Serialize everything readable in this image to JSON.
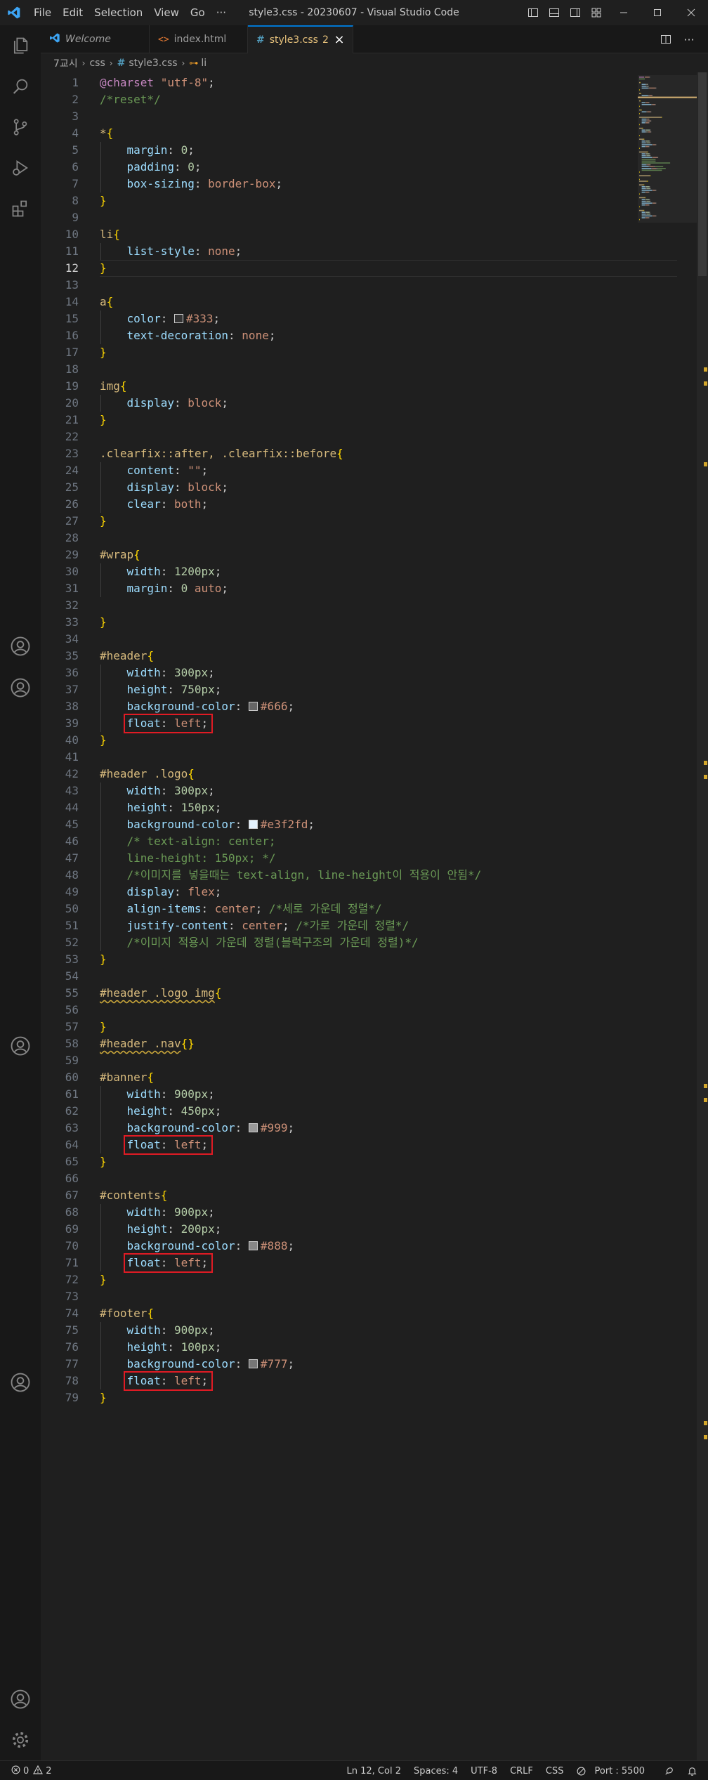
{
  "app": {
    "window_title": "style3.css - 20230607 - Visual Studio Code",
    "menu": [
      "File",
      "Edit",
      "Selection",
      "View",
      "Go",
      "···"
    ]
  },
  "tabs": [
    {
      "label": "Welcome",
      "icon": "vscode-icon",
      "active": false
    },
    {
      "label": "index.html",
      "icon": "html-icon",
      "active": false
    },
    {
      "label": "style3.css",
      "badge": "2",
      "icon": "css-icon",
      "active": true
    }
  ],
  "breadcrumb": [
    "7교시",
    "css",
    "style3.css",
    "li"
  ],
  "cursor_line": 12,
  "lines": [
    [
      [
        "t-at",
        "@charset"
      ],
      [
        "t-plain",
        " "
      ],
      [
        "t-str",
        "\"utf-8\""
      ],
      [
        "t-plain",
        ";"
      ]
    ],
    [
      [
        "t-com",
        "/*reset*/"
      ]
    ],
    [],
    [
      [
        "t-sel",
        "*"
      ],
      [
        "t-br",
        "{"
      ]
    ],
    [
      [
        "t-plain",
        "    "
      ],
      [
        "t-prop",
        "margin"
      ],
      [
        "t-plain",
        ": "
      ],
      [
        "t-num",
        "0"
      ],
      [
        "t-plain",
        ";"
      ]
    ],
    [
      [
        "t-plain",
        "    "
      ],
      [
        "t-prop",
        "padding"
      ],
      [
        "t-plain",
        ": "
      ],
      [
        "t-num",
        "0"
      ],
      [
        "t-plain",
        ";"
      ]
    ],
    [
      [
        "t-plain",
        "    "
      ],
      [
        "t-prop",
        "box-sizing"
      ],
      [
        "t-plain",
        ": "
      ],
      [
        "t-val",
        "border-box"
      ],
      [
        "t-plain",
        ";"
      ]
    ],
    [
      [
        "t-br",
        "}"
      ]
    ],
    [],
    [
      [
        "t-sel",
        "li"
      ],
      [
        "t-br",
        "{"
      ]
    ],
    [
      [
        "t-plain",
        "    "
      ],
      [
        "t-prop",
        "list-style"
      ],
      [
        "t-plain",
        ": "
      ],
      [
        "t-val",
        "none"
      ],
      [
        "t-plain",
        ";"
      ]
    ],
    [
      [
        "t-br",
        "}"
      ]
    ],
    [],
    [
      [
        "t-sel",
        "a"
      ],
      [
        "t-br",
        "{"
      ]
    ],
    [
      [
        "t-plain",
        "    "
      ],
      [
        "t-prop",
        "color"
      ],
      [
        "t-plain",
        ": "
      ],
      [
        "swatch",
        "#333333"
      ],
      [
        "t-val",
        "#333"
      ],
      [
        "t-plain",
        ";"
      ]
    ],
    [
      [
        "t-plain",
        "    "
      ],
      [
        "t-prop",
        "text-decoration"
      ],
      [
        "t-plain",
        ": "
      ],
      [
        "t-val",
        "none"
      ],
      [
        "t-plain",
        ";"
      ]
    ],
    [
      [
        "t-br",
        "}"
      ]
    ],
    [],
    [
      [
        "t-sel",
        "img"
      ],
      [
        "t-br",
        "{"
      ]
    ],
    [
      [
        "t-plain",
        "    "
      ],
      [
        "t-prop",
        "display"
      ],
      [
        "t-plain",
        ": "
      ],
      [
        "t-val",
        "block"
      ],
      [
        "t-plain",
        ";"
      ]
    ],
    [
      [
        "t-br",
        "}"
      ]
    ],
    [],
    [
      [
        "t-sel",
        ".clearfix::after, .clearfix::before"
      ],
      [
        "t-br",
        "{"
      ]
    ],
    [
      [
        "t-plain",
        "    "
      ],
      [
        "t-prop",
        "content"
      ],
      [
        "t-plain",
        ": "
      ],
      [
        "t-str",
        "\"\""
      ],
      [
        "t-plain",
        ";"
      ]
    ],
    [
      [
        "t-plain",
        "    "
      ],
      [
        "t-prop",
        "display"
      ],
      [
        "t-plain",
        ": "
      ],
      [
        "t-val",
        "block"
      ],
      [
        "t-plain",
        ";"
      ]
    ],
    [
      [
        "t-plain",
        "    "
      ],
      [
        "t-prop",
        "clear"
      ],
      [
        "t-plain",
        ": "
      ],
      [
        "t-val",
        "both"
      ],
      [
        "t-plain",
        ";"
      ]
    ],
    [
      [
        "t-br",
        "}"
      ]
    ],
    [],
    [
      [
        "t-sel",
        "#wrap"
      ],
      [
        "t-br",
        "{"
      ]
    ],
    [
      [
        "t-plain",
        "    "
      ],
      [
        "t-prop",
        "width"
      ],
      [
        "t-plain",
        ": "
      ],
      [
        "t-num",
        "1200px"
      ],
      [
        "t-plain",
        ";"
      ]
    ],
    [
      [
        "t-plain",
        "    "
      ],
      [
        "t-prop",
        "margin"
      ],
      [
        "t-plain",
        ": "
      ],
      [
        "t-num",
        "0"
      ],
      [
        "t-plain",
        " "
      ],
      [
        "t-val",
        "auto"
      ],
      [
        "t-plain",
        ";"
      ]
    ],
    [],
    [
      [
        "t-br",
        "}"
      ]
    ],
    [],
    [
      [
        "t-sel",
        "#header"
      ],
      [
        "t-br",
        "{"
      ]
    ],
    [
      [
        "t-plain",
        "    "
      ],
      [
        "t-prop",
        "width"
      ],
      [
        "t-plain",
        ": "
      ],
      [
        "t-num",
        "300px"
      ],
      [
        "t-plain",
        ";"
      ]
    ],
    [
      [
        "t-plain",
        "    "
      ],
      [
        "t-prop",
        "height"
      ],
      [
        "t-plain",
        ": "
      ],
      [
        "t-num",
        "750px"
      ],
      [
        "t-plain",
        ";"
      ]
    ],
    [
      [
        "t-plain",
        "    "
      ],
      [
        "t-prop",
        "background-color"
      ],
      [
        "t-plain",
        ": "
      ],
      [
        "swatch",
        "#666666"
      ],
      [
        "t-val",
        "#666"
      ],
      [
        "t-plain",
        ";"
      ]
    ],
    [
      [
        "t-plain",
        "    "
      ],
      [
        "t-prop",
        "float"
      ],
      [
        "t-plain",
        ": "
      ],
      [
        "t-val",
        "left"
      ],
      [
        "t-plain",
        ";"
      ]
    ],
    [
      [
        "t-br",
        "}"
      ]
    ],
    [],
    [
      [
        "t-sel",
        "#header .logo"
      ],
      [
        "t-br",
        "{"
      ]
    ],
    [
      [
        "t-plain",
        "    "
      ],
      [
        "t-prop",
        "width"
      ],
      [
        "t-plain",
        ": "
      ],
      [
        "t-num",
        "300px"
      ],
      [
        "t-plain",
        ";"
      ]
    ],
    [
      [
        "t-plain",
        "    "
      ],
      [
        "t-prop",
        "height"
      ],
      [
        "t-plain",
        ": "
      ],
      [
        "t-num",
        "150px"
      ],
      [
        "t-plain",
        ";"
      ]
    ],
    [
      [
        "t-plain",
        "    "
      ],
      [
        "t-prop",
        "background-color"
      ],
      [
        "t-plain",
        ": "
      ],
      [
        "swatch",
        "#e3f2fd"
      ],
      [
        "t-val",
        "#e3f2fd"
      ],
      [
        "t-plain",
        ";"
      ]
    ],
    [
      [
        "t-plain",
        "    "
      ],
      [
        "t-com",
        "/* text-align: center;"
      ]
    ],
    [
      [
        "t-plain",
        "    "
      ],
      [
        "t-com",
        "line-height: 150px; */"
      ]
    ],
    [
      [
        "t-plain",
        "    "
      ],
      [
        "t-com",
        "/*이미지를 넣을때는 text-align, line-height이 적용이 안됨*/"
      ]
    ],
    [
      [
        "t-plain",
        "    "
      ],
      [
        "t-prop",
        "display"
      ],
      [
        "t-plain",
        ": "
      ],
      [
        "t-val",
        "flex"
      ],
      [
        "t-plain",
        ";"
      ]
    ],
    [
      [
        "t-plain",
        "    "
      ],
      [
        "t-prop",
        "align-items"
      ],
      [
        "t-plain",
        ": "
      ],
      [
        "t-val",
        "center"
      ],
      [
        "t-plain",
        "; "
      ],
      [
        "t-com",
        "/*세로 가운데 정렬*/"
      ]
    ],
    [
      [
        "t-plain",
        "    "
      ],
      [
        "t-prop",
        "justify-content"
      ],
      [
        "t-plain",
        ": "
      ],
      [
        "t-val",
        "center"
      ],
      [
        "t-plain",
        "; "
      ],
      [
        "t-com",
        "/*가로 가운데 정렬*/"
      ]
    ],
    [
      [
        "t-plain",
        "    "
      ],
      [
        "t-com",
        "/*이미지 적용시 가운데 정렬(블럭구조의 가운데 정렬)*/"
      ]
    ],
    [
      [
        "t-br",
        "}"
      ]
    ],
    [],
    [
      [
        "wavy-sel",
        "#header .logo img"
      ],
      [
        "t-br",
        "{"
      ]
    ],
    [],
    [
      [
        "t-br",
        "}"
      ]
    ],
    [
      [
        "wavy-sel",
        "#header .nav"
      ],
      [
        "t-br",
        "{}"
      ]
    ],
    [],
    [
      [
        "t-sel",
        "#banner"
      ],
      [
        "t-br",
        "{"
      ]
    ],
    [
      [
        "t-plain",
        "    "
      ],
      [
        "t-prop",
        "width"
      ],
      [
        "t-plain",
        ": "
      ],
      [
        "t-num",
        "900px"
      ],
      [
        "t-plain",
        ";"
      ]
    ],
    [
      [
        "t-plain",
        "    "
      ],
      [
        "t-prop",
        "height"
      ],
      [
        "t-plain",
        ": "
      ],
      [
        "t-num",
        "450px"
      ],
      [
        "t-plain",
        ";"
      ]
    ],
    [
      [
        "t-plain",
        "    "
      ],
      [
        "t-prop",
        "background-color"
      ],
      [
        "t-plain",
        ": "
      ],
      [
        "swatch",
        "#999999"
      ],
      [
        "t-val",
        "#999"
      ],
      [
        "t-plain",
        ";"
      ]
    ],
    [
      [
        "t-plain",
        "    "
      ],
      [
        "t-prop",
        "float"
      ],
      [
        "t-plain",
        ": "
      ],
      [
        "t-val",
        "left"
      ],
      [
        "t-plain",
        ";"
      ]
    ],
    [
      [
        "t-br",
        "}"
      ]
    ],
    [],
    [
      [
        "t-sel",
        "#contents"
      ],
      [
        "t-br",
        "{"
      ]
    ],
    [
      [
        "t-plain",
        "    "
      ],
      [
        "t-prop",
        "width"
      ],
      [
        "t-plain",
        ": "
      ],
      [
        "t-num",
        "900px"
      ],
      [
        "t-plain",
        ";"
      ]
    ],
    [
      [
        "t-plain",
        "    "
      ],
      [
        "t-prop",
        "height"
      ],
      [
        "t-plain",
        ": "
      ],
      [
        "t-num",
        "200px"
      ],
      [
        "t-plain",
        ";"
      ]
    ],
    [
      [
        "t-plain",
        "    "
      ],
      [
        "t-prop",
        "background-color"
      ],
      [
        "t-plain",
        ": "
      ],
      [
        "swatch",
        "#888888"
      ],
      [
        "t-val",
        "#888"
      ],
      [
        "t-plain",
        ";"
      ]
    ],
    [
      [
        "t-plain",
        "    "
      ],
      [
        "t-prop",
        "float"
      ],
      [
        "t-plain",
        ": "
      ],
      [
        "t-val",
        "left"
      ],
      [
        "t-plain",
        ";"
      ]
    ],
    [
      [
        "t-br",
        "}"
      ]
    ],
    [],
    [
      [
        "t-sel",
        "#footer"
      ],
      [
        "t-br",
        "{"
      ]
    ],
    [
      [
        "t-plain",
        "    "
      ],
      [
        "t-prop",
        "width"
      ],
      [
        "t-plain",
        ": "
      ],
      [
        "t-num",
        "900px"
      ],
      [
        "t-plain",
        ";"
      ]
    ],
    [
      [
        "t-plain",
        "    "
      ],
      [
        "t-prop",
        "height"
      ],
      [
        "t-plain",
        ": "
      ],
      [
        "t-num",
        "100px"
      ],
      [
        "t-plain",
        ";"
      ]
    ],
    [
      [
        "t-plain",
        "    "
      ],
      [
        "t-prop",
        "background-color"
      ],
      [
        "t-plain",
        ": "
      ],
      [
        "swatch",
        "#777777"
      ],
      [
        "t-val",
        "#777"
      ],
      [
        "t-plain",
        ";"
      ]
    ],
    [
      [
        "t-plain",
        "    "
      ],
      [
        "t-prop",
        "float"
      ],
      [
        "t-plain",
        ": "
      ],
      [
        "t-val",
        "left"
      ],
      [
        "t-plain",
        ";"
      ]
    ],
    [
      [
        "t-br",
        "}"
      ]
    ]
  ],
  "highlighted_lines": [
    39,
    64,
    71,
    78
  ],
  "status": {
    "errors": "0",
    "warnings": "2",
    "position": "Ln 12, Col 2",
    "spaces": "Spaces: 4",
    "encoding": "UTF-8",
    "eol": "CRLF",
    "language": "CSS",
    "port": "Port : 5500"
  },
  "colors": {
    "accent": "#0078d4",
    "highlight_box": "#e01b24"
  }
}
